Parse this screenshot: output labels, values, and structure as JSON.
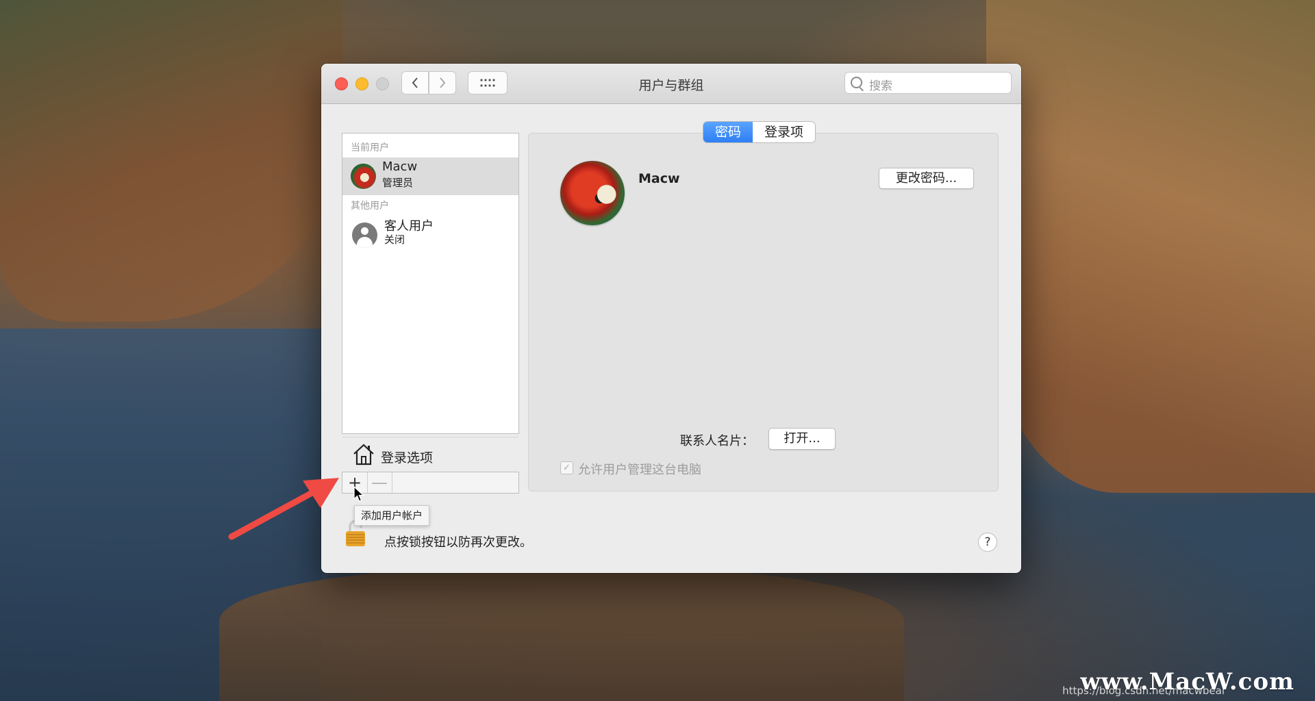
{
  "window": {
    "title": "用户与群组",
    "search_placeholder": "搜索"
  },
  "sidebar": {
    "current_section": "当前用户",
    "current_user": {
      "name": "Macw",
      "role": "管理员"
    },
    "other_section": "其他用户",
    "other_users": [
      {
        "name": "客人用户",
        "status": "关闭"
      }
    ],
    "login_options_label": "登录选项",
    "add_button": "+",
    "remove_button": "—"
  },
  "main": {
    "tabs": [
      {
        "label": "密码",
        "active": true
      },
      {
        "label": "登录项",
        "active": false
      }
    ],
    "username": "Macw",
    "change_password_button": "更改密码...",
    "contact_card_label": "联系人名片：",
    "open_button": "打开...",
    "allow_admin_checkbox": {
      "label": "允许用户管理这台电脑",
      "checked": true,
      "enabled": false
    }
  },
  "tooltip": "添加用户帐户",
  "footer": {
    "lock_text": "点按锁按钮以防再次更改。",
    "help": "?"
  },
  "watermark": {
    "brand": "www.MacW.com",
    "url": "https://blog.csdn.net/macwbear"
  },
  "colors": {
    "accent": "#2f7ff5",
    "close": "#fc5f57",
    "minimize": "#fdbc2e",
    "annotation_arrow": "#ef4a43"
  },
  "icons": [
    "search-icon",
    "back-chevron-icon",
    "forward-chevron-icon",
    "grid-icon",
    "house-icon",
    "lock-icon",
    "help-icon",
    "cursor-icon",
    "arrow-annotation-icon"
  ]
}
